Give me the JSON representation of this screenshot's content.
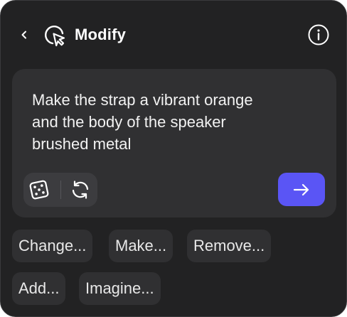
{
  "header": {
    "back_icon": "chevron-left-icon",
    "title_icon": "cursor-click-icon",
    "title": "Modify",
    "info_icon": "info-circle-icon"
  },
  "prompt": {
    "text": "Make the strap a vibrant orange\nand the body of the speaker\nbrushed metal",
    "tools": [
      {
        "icon": "dice-icon"
      },
      {
        "icon": "refresh-icon"
      }
    ],
    "submit_icon": "arrow-right-icon",
    "accent_color": "#5a55f5"
  },
  "suggestions": [
    {
      "label": "Change..."
    },
    {
      "label": "Make..."
    },
    {
      "label": "Remove..."
    },
    {
      "label": "Add..."
    },
    {
      "label": "Imagine..."
    }
  ]
}
